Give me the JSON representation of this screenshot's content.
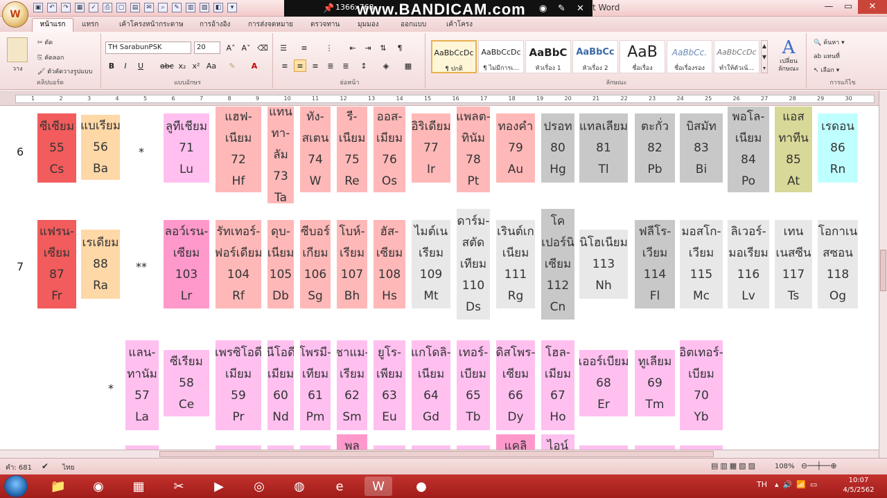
{
  "titlebar": {
    "office_letter": "W",
    "bandicam_resolution": "1366x768",
    "bandicam_logo": "www.BANDICAM.com",
    "window_title_tail": "t Word"
  },
  "tabs": [
    "หน้าแรก",
    "แทรก",
    "เค้าโครงหน้ากระดาษ",
    "การอ้างอิง",
    "การส่งจดหมาย",
    "ตรวจทาน",
    "มุมมอง",
    "ออกแบบ",
    "เค้าโครง"
  ],
  "ribbon": {
    "clipboard": {
      "paste": "วาง",
      "cut": "ตัด",
      "copy": "คัดลอก",
      "format_painter": "ตัวคัดวางรูปแบบ",
      "label": "คลิปบอร์ด"
    },
    "font": {
      "name": "TH SarabunPSK",
      "size": "20",
      "label": "แบบอักษร"
    },
    "paragraph": {
      "label": "ย่อหน้า"
    },
    "styles": {
      "label": "ลักษณะ",
      "items": [
        {
          "sample": "AaBbCcDc",
          "name": "¶ ปกติ"
        },
        {
          "sample": "AaBbCcDc",
          "name": "¶ ไม่มีการเ..."
        },
        {
          "sample": "AaBbC",
          "name": "หัวเรื่อง 1"
        },
        {
          "sample": "AaBbCc",
          "name": "หัวเรื่อง 2"
        },
        {
          "sample": "AaB",
          "name": "ชื่อเรื่อง"
        },
        {
          "sample": "AaBbCc.",
          "name": "ชื่อเรื่องรอง"
        },
        {
          "sample": "AaBbCcDc",
          "name": "ทำให้ตัวเน้..."
        }
      ],
      "change_styles": "เปลี่ยน ลักษณะ"
    },
    "editing": {
      "find": "ค้นหา",
      "replace": "แทนที่",
      "select": "เลือก",
      "label": "การแก้ไข"
    }
  },
  "ruler_numbers": [
    "1",
    "2",
    "3",
    "4",
    "5",
    "6",
    "7",
    "8",
    "9",
    "10",
    "11",
    "12",
    "13",
    "14",
    "15",
    "16",
    "17",
    "18",
    "19",
    "20",
    "21",
    "22",
    "23",
    "24",
    "25",
    "26",
    "27",
    "28",
    "29",
    "30"
  ],
  "table": {
    "rows": [
      {
        "label": "6",
        "marker": "*"
      },
      {
        "label": "7",
        "marker": "**"
      },
      {
        "label": "",
        "marker": "*"
      }
    ],
    "elements": [
      {
        "lines": [
          "ซีเซียม",
          "55",
          "Cs"
        ],
        "color": "#f25c5c"
      },
      {
        "lines": [
          "แบเรียม",
          "56",
          "Ba"
        ],
        "color": "#ffd8a8"
      },
      {
        "lines": [
          "ลูทีเชียม",
          "71",
          "Lu"
        ],
        "color": "#ffc0f0"
      },
      {
        "lines": [
          "แฮฟ-",
          "เนียม",
          "72",
          "Hf"
        ],
        "color": "#ffb8b8"
      },
      {
        "lines": [
          "แทน",
          "ทา-",
          "ลัม",
          "73",
          "Ta"
        ],
        "color": "#ffb8b8"
      },
      {
        "lines": [
          "ทัง-",
          "สเตน",
          "74",
          "W"
        ],
        "color": "#ffb8b8"
      },
      {
        "lines": [
          "รี-",
          "เนียม",
          "75",
          "Re"
        ],
        "color": "#ffb8b8"
      },
      {
        "lines": [
          "ออส-",
          "เมียม",
          "76",
          "Os"
        ],
        "color": "#ffb8b8"
      },
      {
        "lines": [
          "อิริเดียม",
          "77",
          "Ir"
        ],
        "color": "#ffb8b8"
      },
      {
        "lines": [
          "แพลต-",
          "ทินัม",
          "78",
          "Pt"
        ],
        "color": "#ffb8b8"
      },
      {
        "lines": [
          "ทองคำ",
          "79",
          "Au"
        ],
        "color": "#ffb8b8"
      },
      {
        "lines": [
          "ปรอท",
          "80",
          "Hg"
        ],
        "color": "#c8c8c8"
      },
      {
        "lines": [
          "แทลเลียม",
          "81",
          "Tl"
        ],
        "color": "#c8c8c8"
      },
      {
        "lines": [
          "ตะกั่ว",
          "82",
          "Pb"
        ],
        "color": "#c8c8c8"
      },
      {
        "lines": [
          "บิสมัท",
          "83",
          "Bi"
        ],
        "color": "#c8c8c8"
      },
      {
        "lines": [
          "พอโล-",
          "เนียม",
          "84",
          "Po"
        ],
        "color": "#c8c8c8"
      },
      {
        "lines": [
          "แอส",
          "ทาทีน",
          "85",
          "At"
        ],
        "color": "#d8d898"
      },
      {
        "lines": [
          "เรดอน",
          "86",
          "Rn"
        ],
        "color": "#c0ffff"
      },
      {
        "lines": [
          "แฟรน-",
          "เซียม",
          "87",
          "Fr"
        ],
        "color": "#f25c5c"
      },
      {
        "lines": [
          "เรเดียม",
          "88",
          "Ra"
        ],
        "color": "#ffd8a8"
      },
      {
        "lines": [
          "ลอว์เรน-",
          "เซียม",
          "103",
          "Lr"
        ],
        "color": "#ff99cc"
      },
      {
        "lines": [
          "รัทเทอร์-",
          "ฟอร์เดียม",
          "104",
          "Rf"
        ],
        "color": "#ffb8b8"
      },
      {
        "lines": [
          "ดุบ-",
          "เนียม",
          "105",
          "Db"
        ],
        "color": "#ffb8b8"
      },
      {
        "lines": [
          "ซีบอร์",
          "เกียม",
          "106",
          "Sg"
        ],
        "color": "#ffb8b8"
      },
      {
        "lines": [
          "โบห์-",
          "เรียม",
          "107",
          "Bh"
        ],
        "color": "#ffb8b8"
      },
      {
        "lines": [
          "ฮัส-",
          "เซียม",
          "108",
          "Hs"
        ],
        "color": "#ffb8b8"
      },
      {
        "lines": [
          "ไมต์เน",
          "เรียม",
          "109",
          "Mt"
        ],
        "color": "#e8e8e8"
      },
      {
        "lines": [
          "ดาร์ม-",
          "สตัด",
          "เทียม",
          "110",
          "Ds"
        ],
        "color": "#e8e8e8"
      },
      {
        "lines": [
          "เรินต์เก",
          "เนียม",
          "111",
          "Rg"
        ],
        "color": "#e8e8e8"
      },
      {
        "lines": [
          "โค",
          "เปอร์นิ",
          "เซียม",
          "112",
          "Cn"
        ],
        "color": "#c8c8c8"
      },
      {
        "lines": [
          "นิโฮเนียม",
          "113",
          "Nh"
        ],
        "color": "#e8e8e8"
      },
      {
        "lines": [
          "ฟลีโร-",
          "เวียม",
          "114",
          "Fl"
        ],
        "color": "#c8c8c8"
      },
      {
        "lines": [
          "มอสโก-",
          "เวียม",
          "115",
          "Mc"
        ],
        "color": "#e8e8e8"
      },
      {
        "lines": [
          "ลิเวอร์-",
          "มอเรียม",
          "116",
          "Lv"
        ],
        "color": "#e8e8e8"
      },
      {
        "lines": [
          "เทน",
          "เนสซีน",
          "117",
          "Ts"
        ],
        "color": "#e8e8e8"
      },
      {
        "lines": [
          "โอกาเน",
          "สซอน",
          "118",
          "Og"
        ],
        "color": "#e8e8e8"
      },
      {
        "lines": [
          "แลน-",
          "ทานัม",
          "57",
          "La"
        ],
        "color": "#ffc0f0"
      },
      {
        "lines": [
          "ซีเรียม",
          "58",
          "Ce"
        ],
        "color": "#ffc0f0"
      },
      {
        "lines": [
          "เพรซิโอดี",
          "เมียม",
          "59",
          "Pr"
        ],
        "color": "#ffc0f0"
      },
      {
        "lines": [
          "นีโอดี",
          "เมียม",
          "60",
          "Nd"
        ],
        "color": "#ffc0f0"
      },
      {
        "lines": [
          "โพรมี-",
          "เทียม",
          "61",
          "Pm"
        ],
        "color": "#ffc0f0"
      },
      {
        "lines": [
          "ซาแม-",
          "เรียม",
          "62",
          "Sm"
        ],
        "color": "#ffc0f0"
      },
      {
        "lines": [
          "ยูโร-",
          "เพียม",
          "63",
          "Eu"
        ],
        "color": "#ffc0f0"
      },
      {
        "lines": [
          "แกโดลิ-",
          "เนียม",
          "64",
          "Gd"
        ],
        "color": "#ffc0f0"
      },
      {
        "lines": [
          "เทอร์-",
          "เบียม",
          "65",
          "Tb"
        ],
        "color": "#ffc0f0"
      },
      {
        "lines": [
          "ดิสโพร-",
          "เซียม",
          "66",
          "Dy"
        ],
        "color": "#ffc0f0"
      },
      {
        "lines": [
          "โฮล-",
          "เมียม",
          "67",
          "Ho"
        ],
        "color": "#ffc0f0"
      },
      {
        "lines": [
          "เออร์เบียม",
          "68",
          "Er"
        ],
        "color": "#ffc0f0"
      },
      {
        "lines": [
          "ทูเลียม",
          "69",
          "Tm"
        ],
        "color": "#ffc0f0"
      },
      {
        "lines": [
          "อิตเทอร์-",
          "เบียม",
          "70",
          "Yb"
        ],
        "color": "#ffc0f0"
      }
    ],
    "partial_row_text": [
      "พล",
      "แคลิ",
      "ไอน์"
    ]
  },
  "statusbar": {
    "word_count": "คำ: 681",
    "language": "ไทย",
    "zoom": "108%"
  },
  "taskbar": {
    "tray_lang": "TH",
    "time": "10:07",
    "date": "4/5/2562"
  },
  "colors": {
    "accent_ribbon": "#f3dcdc",
    "taskbar": "#b0231f",
    "closebtn": "#c9453a"
  }
}
